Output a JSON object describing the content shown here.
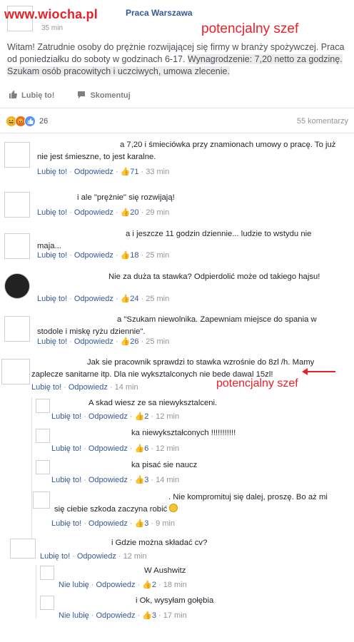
{
  "watermark": "www.wiocha.pl",
  "post": {
    "page_name": "Praca Warszawa",
    "time": "35 min",
    "annotation": "potencjalny szef",
    "text_1": "Witam! Zatrudnie osoby do prężnie rozwijającej się firmy w branży spożywczej. Praca od poniedziałku do soboty w godzinach 6-17.",
    "text_2": "Wynagrodzenie: 7,20 netto za godzinę. Szukam osób pracowitych i uczciwych, umowa zlecenie.",
    "like_label": "Lubię to!",
    "comment_label": "Skomentuj"
  },
  "reactions": {
    "count": "26",
    "comments_count": "55 komentarzy"
  },
  "meta_labels": {
    "like": "Lubię to!",
    "unlike": "Nie lubię",
    "reply": "Odpowiedz"
  },
  "comments": [
    {
      "text": "a 7,20 i śmieciówka przy znamionach umowy o pracę. To już nie jest śmieszne, to jest karalne.",
      "likes": "71",
      "time": "33 min"
    },
    {
      "text": "i ale \"prężnie\" się rozwijają!",
      "likes": "20",
      "time": "29 min"
    },
    {
      "text": "a i jeszcze 11 godzin dziennie... ludzie to wstydu nie maja...",
      "likes": "18",
      "time": "25 min"
    },
    {
      "text": "Nie za duża ta stawka? Odpierdolić może od takiego hajsu!",
      "likes": "24",
      "time": "25 min"
    },
    {
      "text": "a \"Szukam niewolnika. Zapewniam miejsce do spania w stodole i miskę ryżu dziennie\".",
      "likes": "26",
      "time": "25 min"
    },
    {
      "text": "Jak sie pracownik sprawdzi to stawka wzrośnie do 8zl /h. Mamy zaplecze sanitarne itp. Dla nie wyksztalconych nie bede dawal 15zl!",
      "likes": "",
      "time": "14 min",
      "annotation": "potencjalny szef"
    },
    {
      "text": "A skad wiesz ze sa niewyksztalceni.",
      "likes": "2",
      "time": "12 min"
    },
    {
      "text": "ka niewykształconych !!!!!!!!!!!",
      "likes": "6",
      "time": "12 min"
    },
    {
      "text": "ka pisać sie naucz",
      "likes": "3",
      "time": "14 min"
    },
    {
      "text": ". Nie kompromituj się dalej, proszę. Bo aż mi się ciebie szkoda zaczyna robić",
      "likes": "3",
      "time": "9 min"
    },
    {
      "text": "i Gdzie można składać cv?",
      "likes": "",
      "time": "12 min"
    },
    {
      "text": "W Aushwitz",
      "likes": "2",
      "time": "18 min"
    },
    {
      "text": "i Ok, wysyłam gołębia",
      "likes": "3",
      "time": "17 min"
    }
  ]
}
